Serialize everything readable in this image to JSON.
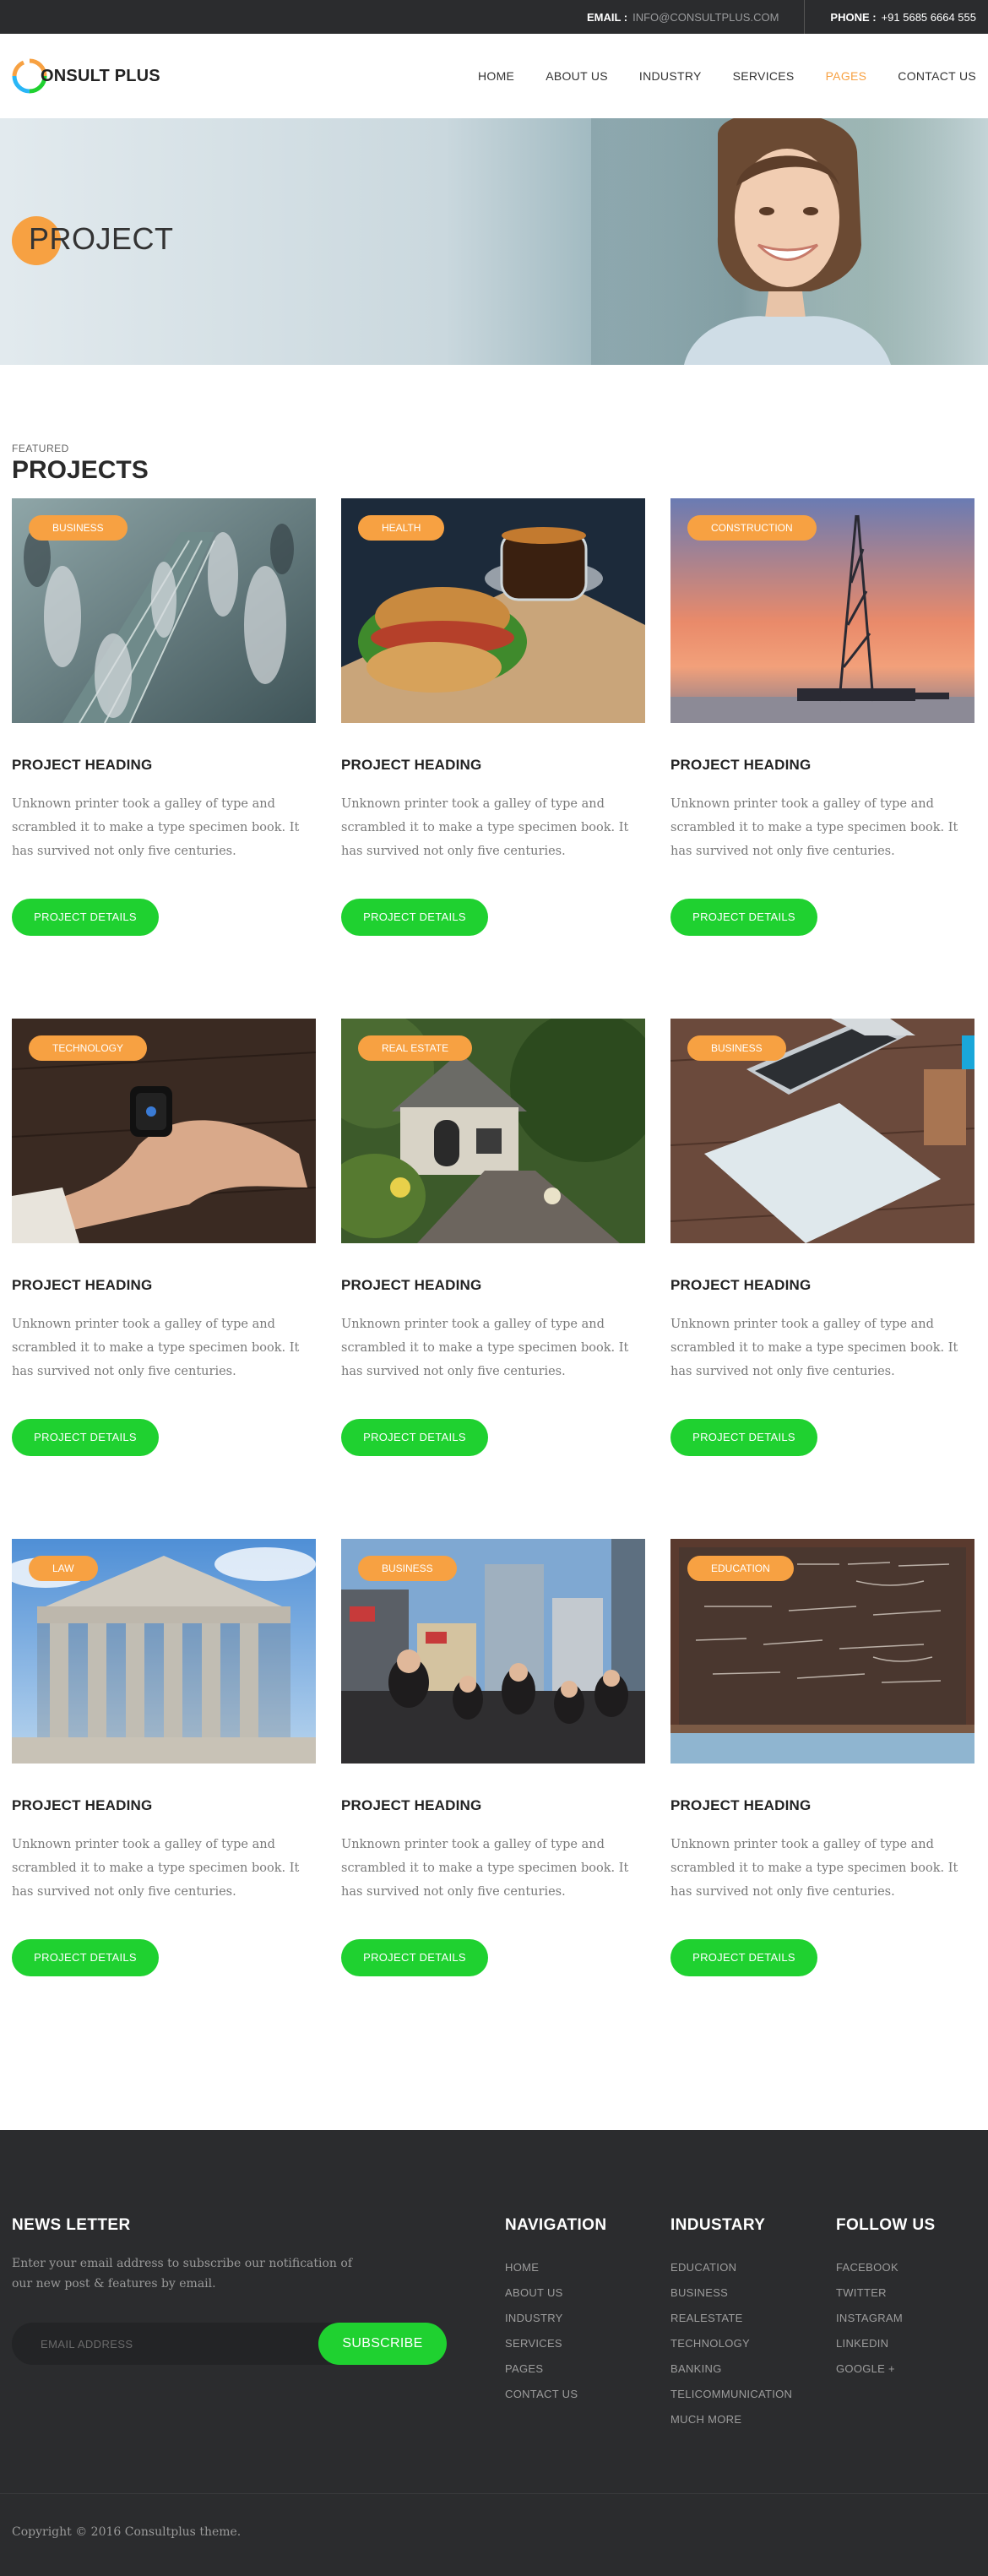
{
  "topbar": {
    "email_label": "EMAIL :",
    "email_value": "INFO@CONSULTPLUS.COM",
    "phone_label": "PHONE :",
    "phone_value": "+91 5685 6664 555"
  },
  "logo": {
    "text": "ONSULT PLUS"
  },
  "nav": [
    {
      "label": "HOME"
    },
    {
      "label": "ABOUT US"
    },
    {
      "label": "INDUSTRY"
    },
    {
      "label": "SERVICES"
    },
    {
      "label": "PAGES"
    },
    {
      "label": "CONTACT US"
    }
  ],
  "nav_active": "PAGES",
  "hero": {
    "title": "PROJECT"
  },
  "projects": {
    "subtitle": "FEATURED",
    "title": "PROJECTS",
    "cards": [
      {
        "category": "BUSINESS",
        "heading": "PROJECT HEADING",
        "text": "Unknown printer took a galley of type and scrambled it to make a type specimen book. It has survived not only five centuries.",
        "button": "PROJECT DETAILS",
        "image": "escalator-crowd"
      },
      {
        "category": "HEALTH",
        "heading": "PROJECT HEADING",
        "text": "Unknown printer took a galley of type and scrambled it to make a type specimen book. It has survived not only five centuries.",
        "button": "PROJECT DETAILS",
        "image": "sandwich-tea"
      },
      {
        "category": "CONSTRUCTION",
        "heading": "PROJECT HEADING",
        "text": "Unknown printer took a galley of type and scrambled it to make a type specimen book. It has survived not only five centuries.",
        "button": "PROJECT DETAILS",
        "image": "drilling-rig-sunset"
      },
      {
        "category": "TECHNOLOGY",
        "heading": "PROJECT HEADING",
        "text": "Unknown printer took a galley of type and scrambled it to make a type specimen book. It has survived not only five centuries.",
        "button": "PROJECT DETAILS",
        "image": "smartwatch-hand"
      },
      {
        "category": "REAL ESTATE",
        "heading": "PROJECT HEADING",
        "text": "Unknown printer took a galley of type and scrambled it to make a type specimen book. It has survived not only five centuries.",
        "button": "PROJECT DETAILS",
        "image": "house-garden"
      },
      {
        "category": "BUSINESS",
        "heading": "PROJECT HEADING",
        "text": "Unknown printer took a galley of type and scrambled it to make a type specimen book. It has survived not only five centuries.",
        "button": "PROJECT DETAILS",
        "image": "laptop-desk"
      },
      {
        "category": "LAW",
        "heading": "PROJECT HEADING",
        "text": "Unknown printer took a galley of type and scrambled it to make a type specimen book. It has survived not only five centuries.",
        "button": "PROJECT DETAILS",
        "image": "courthouse"
      },
      {
        "category": "BUSINESS",
        "heading": "PROJECT HEADING",
        "text": "Unknown printer took a galley of type and scrambled it to make a type specimen book. It has survived not only five centuries.",
        "button": "PROJECT DETAILS",
        "image": "city-crowd"
      },
      {
        "category": "EDUCATION",
        "heading": "PROJECT HEADING",
        "text": "Unknown printer took a galley of type and scrambled it to make a type specimen book. It has survived not only five centuries.",
        "button": "PROJECT DETAILS",
        "image": "chalkboard"
      }
    ]
  },
  "footer": {
    "newsletter": {
      "title": "NEWS LETTER",
      "text": "Enter your email address to subscribe our notification of our new post & features by email.",
      "placeholder": "EMAIL ADDRESS",
      "button": "SUBSCRIBE"
    },
    "navigation": {
      "title": "NAVIGATION",
      "items": [
        "HOME",
        "ABOUT US",
        "INDUSTRY",
        "SERVICES",
        "PAGES",
        "CONTACT US"
      ]
    },
    "industry": {
      "title": "INDUSTARY",
      "items": [
        "EDUCATION",
        "BUSINESS",
        "REALESTATE",
        "TECHNOLOGY",
        "BANKING",
        "TELICOMMUNICATION",
        "MUCH MORE"
      ]
    },
    "follow": {
      "title": "FOLLOW US",
      "items": [
        "FACEBOOK",
        "TWITTER",
        "INSTAGRAM",
        "LINKEDIN",
        "GOOGLE +"
      ]
    },
    "copyright": "Copyright © 2016 Consultplus theme."
  },
  "colors": {
    "accent": "#f7a142",
    "button": "#1fd130",
    "dark": "#2b2c2e"
  }
}
